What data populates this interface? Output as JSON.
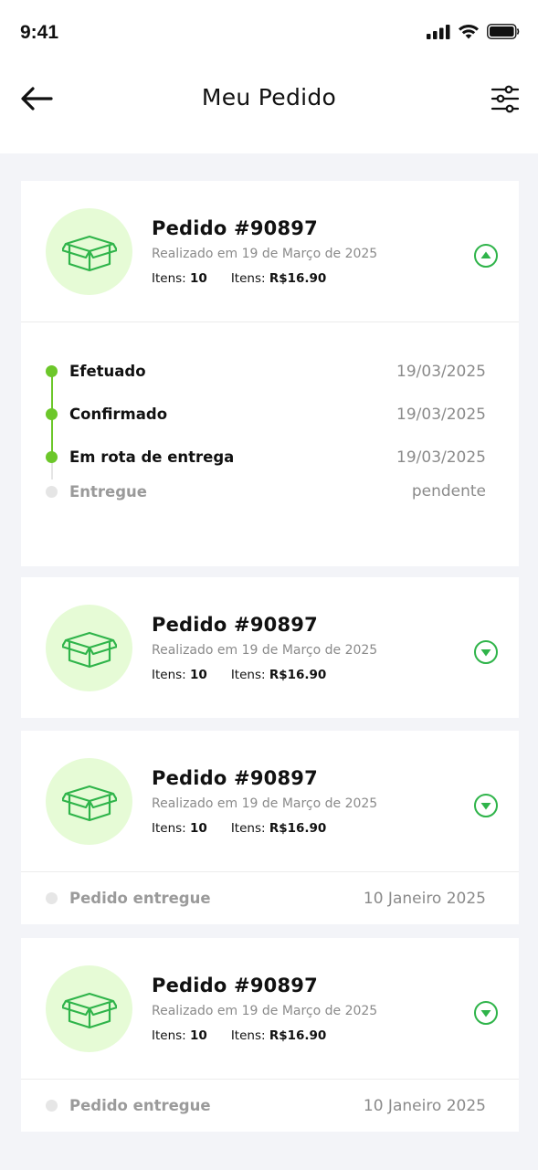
{
  "status_bar": {
    "time": "9:41"
  },
  "header": {
    "title": "Meu Pedido"
  },
  "colors": {
    "accent": "#6cc72a",
    "icon_green": "#2fb44a",
    "avatar_bg": "#e6fbd6",
    "background": "#f3f4f8"
  },
  "orders": [
    {
      "title": "Pedido #90897",
      "subtitle": "Realizado em 19 de Março de 2025",
      "items_label": "Itens:",
      "items_value": "10",
      "price_label": "Itens:",
      "price_value": "R$16.90",
      "expanded": true,
      "timeline": [
        {
          "label": "Efetuado",
          "date": "19/03/2025",
          "done": true
        },
        {
          "label": "Confirmado",
          "date": "19/03/2025",
          "done": true
        },
        {
          "label": "Em rota de entrega",
          "date": "19/03/2025",
          "done": true
        },
        {
          "label": "Entregue",
          "date": "pendente",
          "done": false
        }
      ]
    },
    {
      "title": "Pedido #90897",
      "subtitle": "Realizado em 19 de Março de 2025",
      "items_label": "Itens:",
      "items_value": "10",
      "price_label": "Itens:",
      "price_value": "R$16.90",
      "expanded": false
    },
    {
      "title": "Pedido #90897",
      "subtitle": "Realizado em 19 de Março de 2025",
      "items_label": "Itens:",
      "items_value": "10",
      "price_label": "Itens:",
      "price_value": "R$16.90",
      "expanded": false,
      "footer": {
        "label": "Pedido entregue",
        "date": "10 Janeiro 2025"
      }
    },
    {
      "title": "Pedido #90897",
      "subtitle": "Realizado em 19 de Março de 2025",
      "items_label": "Itens:",
      "items_value": "10",
      "price_label": "Itens:",
      "price_value": "R$16.90",
      "expanded": false,
      "footer": {
        "label": "Pedido entregue",
        "date": "10 Janeiro 2025"
      }
    }
  ]
}
